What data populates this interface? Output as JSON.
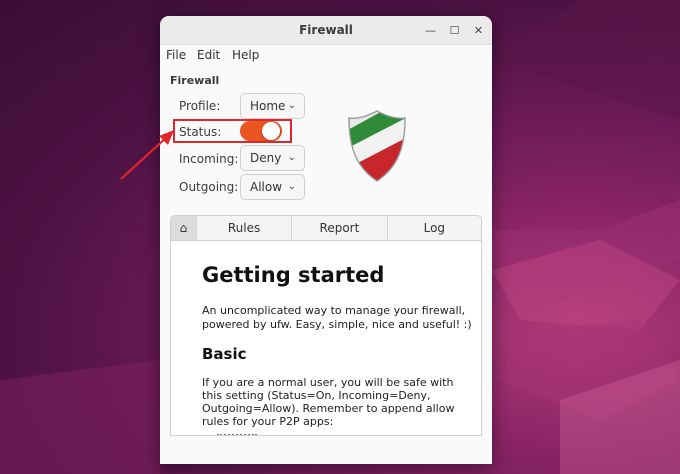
{
  "window": {
    "title": "Firewall"
  },
  "menu": {
    "file": "File",
    "edit": "Edit",
    "help": "Help"
  },
  "section": "Firewall",
  "profile": {
    "label": "Profile:",
    "value": "Home"
  },
  "status": {
    "label": "Status:",
    "enabled": true
  },
  "incoming": {
    "label": "Incoming:",
    "value": "Deny"
  },
  "outgoing": {
    "label": "Outgoing:",
    "value": "Allow"
  },
  "tabs": {
    "home_icon": "home-icon",
    "rules": "Rules",
    "report": "Report",
    "log": "Log"
  },
  "page": {
    "heading": "Getting started",
    "intro": "An uncomplicated way to manage your firewall, powered by ufw. Easy, simple, nice and useful! :)",
    "subheading": "Basic",
    "body": "If you are a normal user, you will be safe with this setting (Status=On, Incoming=Deny, Outgoing=Allow). Remember to append allow rules for your P2P apps:"
  },
  "colors": {
    "accent": "#e95420",
    "highlight": "#e0262a",
    "shield_green": "#2f8a3a",
    "shield_red": "#c8262d"
  }
}
